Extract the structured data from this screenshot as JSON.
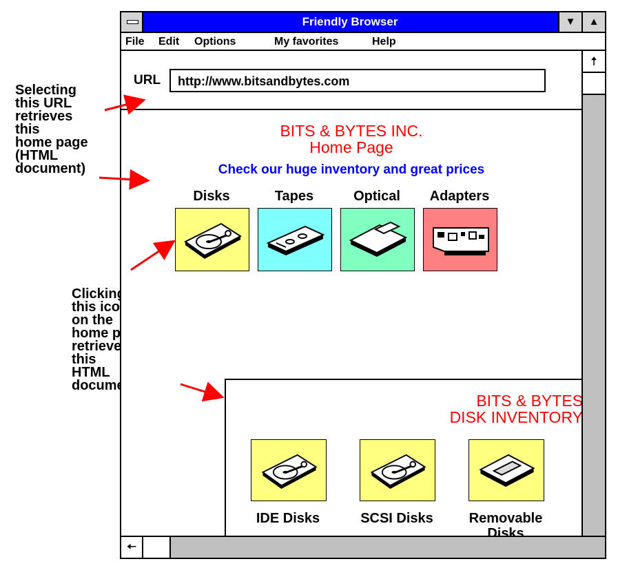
{
  "window": {
    "title": "Friendly Browser",
    "menu": [
      "File",
      "Edit",
      "Options",
      "My favorites",
      "Help"
    ],
    "url_label": "URL",
    "url": "http://www.bitsandbytes.com"
  },
  "home_page": {
    "title_line1": "BITS & BYTES INC.",
    "title_line2": "Home Page",
    "tagline": "Check our huge inventory and great prices",
    "categories": [
      {
        "label": "Disks",
        "color": "#ffff80",
        "icon": "hard-disk-icon"
      },
      {
        "label": "Tapes",
        "color": "#80ffff",
        "icon": "tape-icon"
      },
      {
        "label": "Optical",
        "color": "#80ffc0",
        "icon": "optical-disk-icon"
      },
      {
        "label": "Adapters",
        "color": "#ff8080",
        "icon": "adapter-card-icon"
      }
    ]
  },
  "disk_page": {
    "title_line1": "BITS & BYTES",
    "title_line2": "DISK INVENTORY",
    "items": [
      {
        "label": "IDE Disks",
        "icon": "hard-disk-icon"
      },
      {
        "label": "SCSI Disks",
        "icon": "hard-disk-icon"
      },
      {
        "label": "Removable",
        "label2": "Disks",
        "icon": "removable-disk-icon"
      }
    ]
  },
  "annotations": {
    "url_note": [
      "Selecting",
      "this URL",
      "retrieves",
      "this",
      "home page",
      "(HTML",
      "document)"
    ],
    "icon_note": [
      "Clicking",
      "this icon",
      "on the",
      "home page",
      "retrieves",
      "this",
      "HTML",
      "document"
    ]
  },
  "colors": {
    "title_bar": "#0000ff",
    "heading": "#ff0000",
    "tagline": "#0000ff",
    "arrow": "#ff0000"
  }
}
